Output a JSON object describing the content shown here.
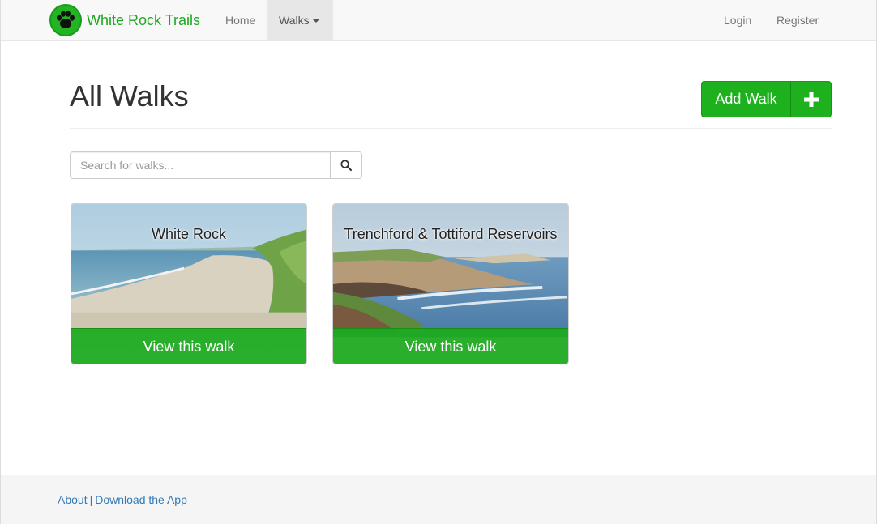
{
  "navbar": {
    "brand": "White Rock Trails",
    "home": "Home",
    "walks": "Walks",
    "login": "Login",
    "register": "Register"
  },
  "header": {
    "title": "All Walks",
    "add_walk_label": "Add Walk"
  },
  "search": {
    "placeholder": "Search for walks..."
  },
  "walks": [
    {
      "title": "White Rock",
      "button": "View this walk"
    },
    {
      "title": "Trenchford & Tottiford Reservoirs",
      "button": "View this walk"
    }
  ],
  "footer": {
    "about": "About",
    "separator": "|",
    "download": "Download the App"
  },
  "colors": {
    "brand_green": "#1fa81f",
    "button_green": "#1db21d",
    "link_blue": "#337ab7"
  }
}
